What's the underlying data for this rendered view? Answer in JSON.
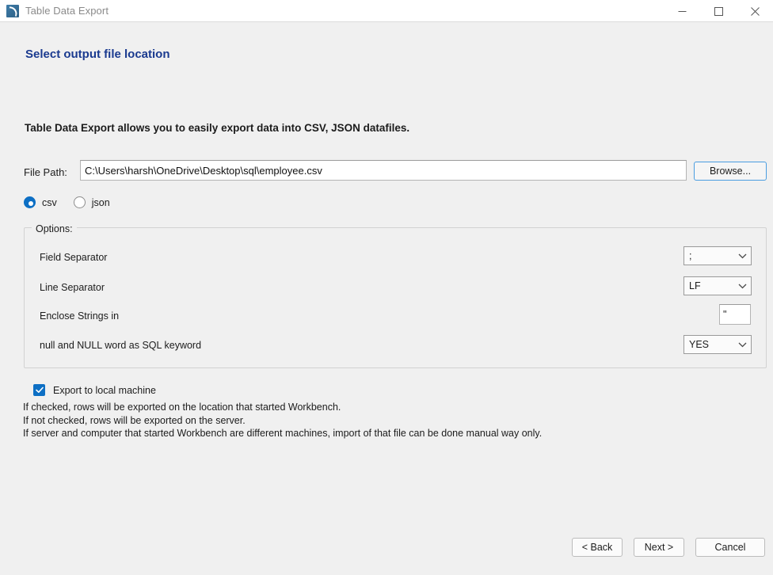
{
  "window": {
    "title": "Table Data Export",
    "icon": "mysql-workbench-dolphin-icon",
    "controls": {
      "minimize": "minimize-icon",
      "maximize": "maximize-icon",
      "close": "close-icon"
    }
  },
  "wizard": {
    "heading": "Select output file location",
    "heading_color": "#1a3a8f",
    "intro": "Table Data Export allows you to easily export data into CSV, JSON datafiles."
  },
  "file_path": {
    "label": "File Path:",
    "value": "C:\\Users\\harsh\\OneDrive\\Desktop\\sql\\employee.csv",
    "placeholder": "",
    "browse_label": "Browse..."
  },
  "format": {
    "selected": "csv",
    "options": [
      {
        "id": "csv",
        "label": "csv",
        "selected": true
      },
      {
        "id": "json",
        "label": "json",
        "selected": false
      }
    ]
  },
  "options": {
    "group_title": "Options:",
    "rows": [
      {
        "label": "Field Separator",
        "control": "combo",
        "value": ";"
      },
      {
        "label": "Line Separator",
        "control": "combo",
        "value": "LF"
      },
      {
        "label": "Enclose Strings in",
        "control": "text",
        "value": "\""
      },
      {
        "label": "null and NULL word as SQL keyword",
        "control": "combo",
        "value": "YES"
      }
    ]
  },
  "export_local": {
    "label": "Export to local machine",
    "checked": true,
    "notes": [
      "If checked, rows will be exported on the location that started Workbench.",
      "If not checked, rows will be exported on the server.",
      "If server and computer that started Workbench are different machines, import of that file can be done manual way only."
    ]
  },
  "footer": {
    "back_label": "< Back",
    "next_label": "Next >",
    "cancel_label": "Cancel"
  },
  "colors": {
    "background": "#f0f0f0",
    "titlebar": "#ffffff",
    "accent": "#0d6fc4",
    "heading": "#1a3a8f",
    "focus_border": "#4a9de0"
  }
}
